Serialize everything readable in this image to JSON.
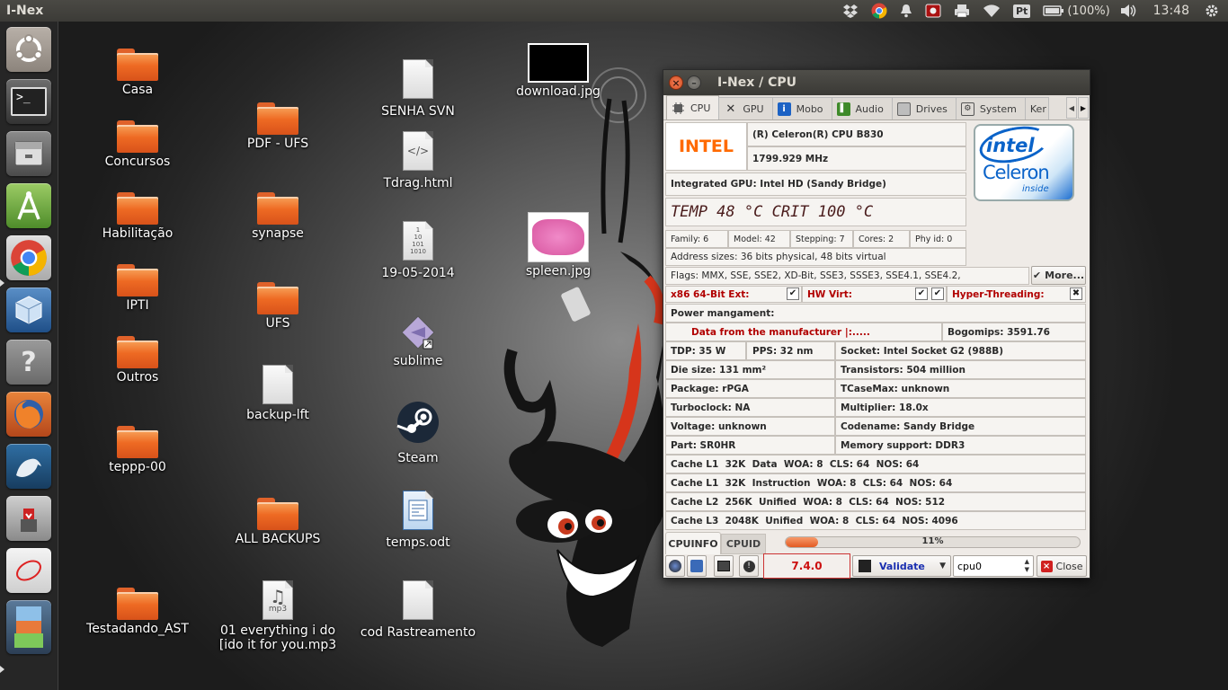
{
  "panel": {
    "app_name": "I-Nex",
    "battery": "(100%)",
    "clock": "13:48",
    "tray_icons": [
      "dropbox-icon",
      "chrome-icon",
      "bell-icon",
      "record-icon",
      "printer-icon",
      "wifi-icon",
      "pt-icon",
      "battery-icon",
      "volume-icon",
      "settings-gear-icon"
    ],
    "pt_label": "Pt"
  },
  "launcher": {
    "items": [
      "ubuntu-home",
      "terminal",
      "files",
      "android-studio",
      "chrome",
      "virtualbox",
      "unknown-app",
      "firefox",
      "mysql-workbench",
      "usb-installer",
      "gksu",
      "bottom-stack"
    ]
  },
  "desktop": {
    "col1": [
      "Casa",
      "Concursos",
      "Habilitação",
      "IPTI",
      "Outros",
      "teppp-00",
      "Testadando_AST"
    ],
    "col2": [
      "PDF - UFS",
      "synapse",
      "UFS",
      "backup-lft",
      "ALL BACKUPS",
      "01 everything i do",
      "[ido it for you.mp3"
    ],
    "col3": [
      "SENHA SVN",
      "Tdrag.html",
      "19-05-2014",
      "sublime",
      "Steam",
      "temps.odt",
      "cod Rastreamento"
    ],
    "col4": [
      "download.jpg",
      "spleen.jpg"
    ],
    "doc_glyphs": {
      "html": "</>",
      "binary": "1\n10\n101\n1010",
      "mp3": "mp3"
    }
  },
  "window": {
    "title": "I-Nex / CPU",
    "tabs": [
      "CPU",
      "GPU",
      "Mobo",
      "Audio",
      "Drives",
      "System",
      "Ker"
    ],
    "vendor": "INTEL",
    "model": "(R) Celeron(R) CPU B830",
    "freq": "1799.929 MHz",
    "igpu": "Integrated GPU: Intel HD (Sandy Bridge)",
    "temp": "TEMP 48 °C CRIT 100 °C",
    "logo_brand": "intel",
    "logo_product": "Celeron",
    "logo_inside": "inside",
    "family": "Family: 6",
    "modelno": "Model: 42",
    "stepping": "Stepping: 7",
    "cores": "Cores: 2",
    "phyid": "Phy id: 0",
    "address": "Address sizes: 36 bits physical, 48 bits virtual",
    "flags": "Flags: MMX, SSE, SSE2, XD-Bit, SSE3, SSSE3, SSE4.1, SSE4.2,",
    "more": "More...",
    "x86": "x86 64-Bit Ext:",
    "hwvirt": "HW Virt:",
    "ht": "Hyper-Threading:",
    "power": "Power mangament:",
    "manuf": "Data from the manufacturer |:.....",
    "bogomips": "Bogomips: 3591.76",
    "tdp": "TDP: 35 W",
    "pps": "PPS: 32 nm",
    "socket": "Socket: Intel Socket G2 (988B)",
    "die": "Die size: 131 mm²",
    "trans": "Transistors: 504 million",
    "package": "Package: rPGA",
    "tcase": "TCaseMax: unknown",
    "turbo": "Turboclock: NA",
    "mult": "Multiplier: 18.0x",
    "volt": "Voltage: unknown",
    "codename": "Codename: Sandy Bridge",
    "part": "Part: SR0HR",
    "mem": "Memory support: DDR3",
    "cache": [
      "Cache L1  32K  Data  WOA: 8  CLS: 64  NOS: 64",
      "Cache L1  32K  Instruction  WOA: 8  CLS: 64  NOS: 64",
      "Cache L2  256K  Unified  WOA: 8  CLS: 64  NOS: 512",
      "Cache L3  2048K  Unified  WOA: 8  CLS: 64  NOS: 4096"
    ],
    "subtabs": [
      "CPUINFO",
      "CPUID"
    ],
    "usage_label": "11%",
    "usage_fraction": 0.11,
    "version": "7.4.0",
    "validate": "Validate",
    "cpu_select": "cpu0",
    "close": "Close"
  }
}
